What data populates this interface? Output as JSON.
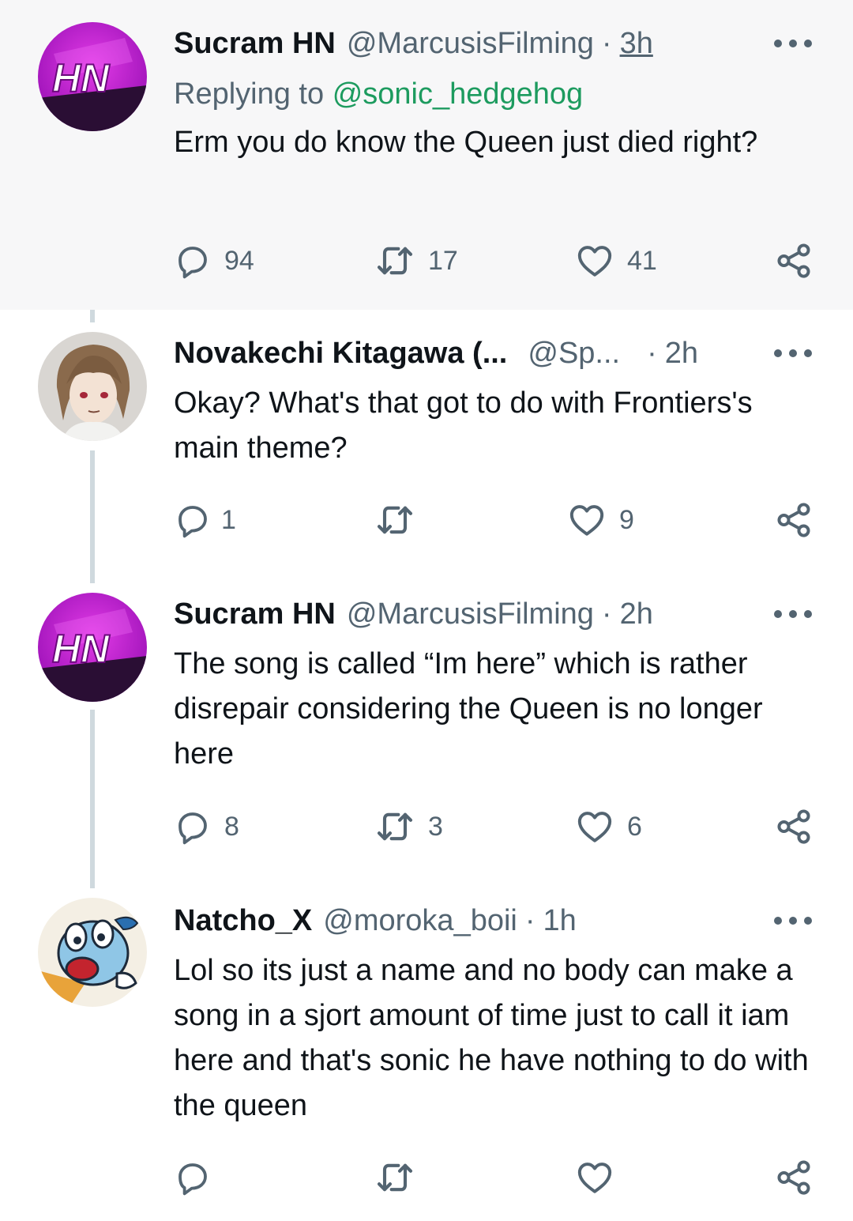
{
  "tweets": [
    {
      "name": "Sucram HN",
      "handle": "@MarcusisFilming",
      "time": "3h",
      "replying_prefix": "Replying to",
      "replying_to": "@sonic_hedgehog",
      "text": "Erm you do know the Queen just died right?",
      "replies": "94",
      "retweets": "17",
      "likes": "41",
      "avatar": "hn-logo-avatar"
    },
    {
      "name": "Novakechi Kitagawa (...",
      "handle": "@Sp...",
      "time": "2h",
      "text": "Okay? What's that got to do with Frontiers's main theme?",
      "replies": "1",
      "retweets": "",
      "likes": "9",
      "avatar": "anime-character-avatar"
    },
    {
      "name": "Sucram HN",
      "handle": "@MarcusisFilming",
      "time": "2h",
      "text": "The song is called “Im here” which is rather disrepair considering the Queen is no longer here",
      "replies": "8",
      "retweets": "3",
      "likes": "6",
      "avatar": "hn-logo-avatar"
    },
    {
      "name": "Natcho_X",
      "handle": "@moroka_boii",
      "time": "1h",
      "text": "Lol so its just a name and no body can make a song in a sjort amount of time just to call it iam here and that's sonic he have nothing to do with the queen",
      "replies": "",
      "retweets": "",
      "likes": "",
      "avatar": "cartoon-character-avatar"
    }
  ],
  "separator": "·",
  "colors": {
    "link": "#1d9b5f",
    "secondary_text": "#536471",
    "thread_line": "#cfd9de",
    "highlight_bg": "#f7f7f8"
  }
}
